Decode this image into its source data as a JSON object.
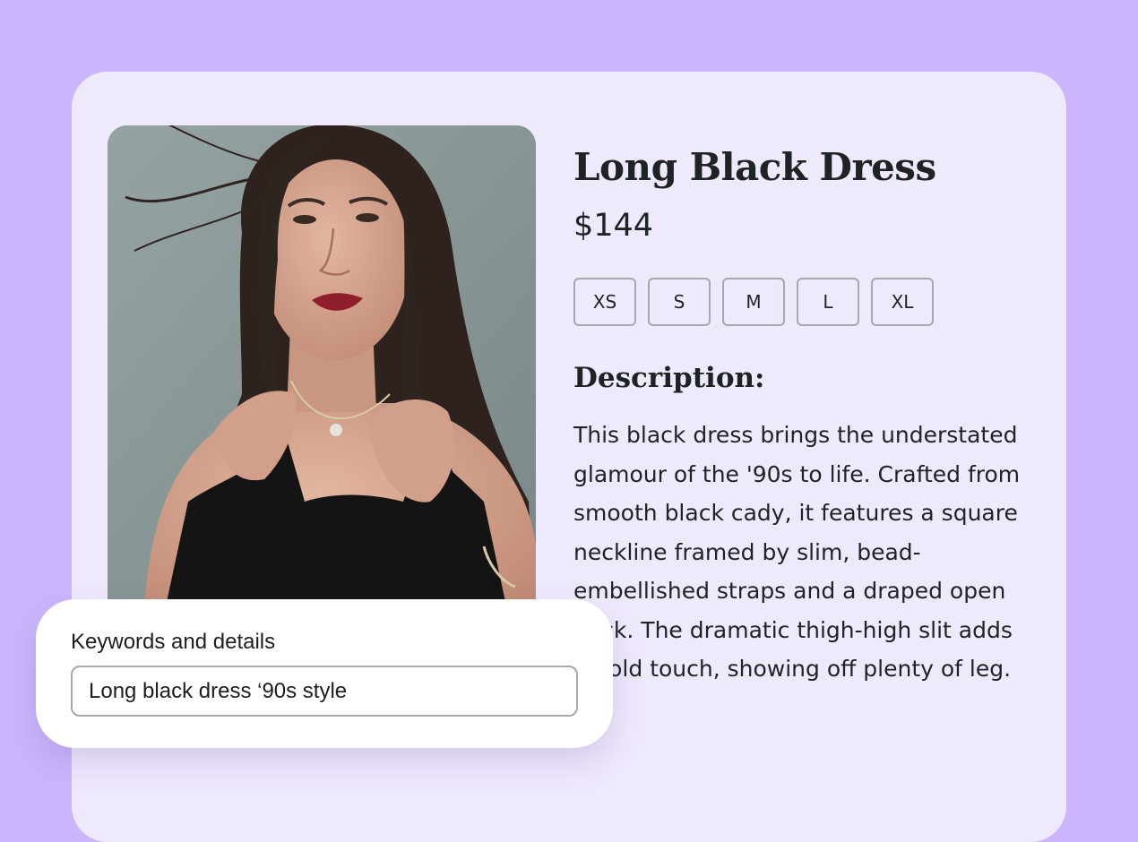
{
  "product": {
    "title": "Long Black Dress",
    "price": "$144",
    "sizes": [
      "XS",
      "S",
      "M",
      "L",
      "XL"
    ],
    "description_heading": "Description:",
    "description": "This black dress brings the understated glamour of the '90s to life. Crafted from smooth black cady, it features a square neckline framed by slim, bead-embellished straps and a draped open back. The dramatic thigh-high slit adds a bold touch, showing off plenty of leg."
  },
  "keywords_panel": {
    "label": "Keywords and details",
    "input_value": "Long black dress ‘90s style"
  },
  "colors": {
    "page_background": "#cbb6fd",
    "card_background": "#efe9fd",
    "text": "#1e2324"
  }
}
